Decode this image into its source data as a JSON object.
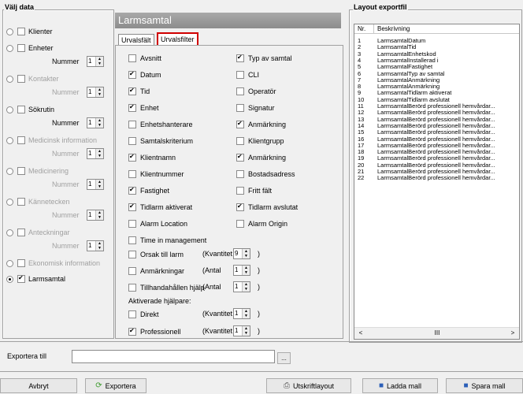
{
  "left": {
    "title": "Välj data",
    "number_label": "Nummer",
    "items": [
      {
        "label": "Klienter",
        "enabled": true,
        "selected": false,
        "checked": false,
        "number": null
      },
      {
        "label": "Enheter",
        "enabled": true,
        "selected": false,
        "checked": false,
        "number": "1"
      },
      {
        "label": "Kontakter",
        "enabled": false,
        "selected": false,
        "checked": false,
        "number": "1"
      },
      {
        "label": "Sökrutin",
        "enabled": true,
        "selected": false,
        "checked": false,
        "number": "1"
      },
      {
        "label": "Medicinsk information",
        "enabled": false,
        "selected": false,
        "checked": false,
        "number": "1"
      },
      {
        "label": "Medicinering",
        "enabled": false,
        "selected": false,
        "checked": false,
        "number": "1"
      },
      {
        "label": "Kännetecken",
        "enabled": false,
        "selected": false,
        "checked": false,
        "number": "1"
      },
      {
        "label": "Anteckningar",
        "enabled": false,
        "selected": false,
        "checked": false,
        "number": "1"
      },
      {
        "label": "Ekonomisk information",
        "enabled": false,
        "selected": false,
        "checked": false,
        "number": null
      },
      {
        "label": "Larmsamtal",
        "enabled": true,
        "selected": true,
        "checked": true,
        "number": null
      }
    ]
  },
  "header": {
    "title": "Larmsamtal"
  },
  "tabs": [
    {
      "label": "Urvalsfält",
      "selected": false
    },
    {
      "label": "Urvalsfilter",
      "selected": true
    }
  ],
  "options_left": [
    {
      "label": "Avsnitt",
      "checked": false
    },
    {
      "label": "Datum",
      "checked": true
    },
    {
      "label": "Tid",
      "checked": true
    },
    {
      "label": "Enhet",
      "checked": true
    },
    {
      "label": "Enhetshanterare",
      "checked": false
    },
    {
      "label": "Samtalskriterium",
      "checked": false
    },
    {
      "label": "Klientnamn",
      "checked": true
    },
    {
      "label": "Klientnummer",
      "checked": false
    },
    {
      "label": "Fastighet",
      "checked": true
    },
    {
      "label": "Tidlarm aktiverat",
      "checked": true
    },
    {
      "label": "Alarm Location",
      "checked": false
    },
    {
      "label": "Time in management",
      "checked": false
    }
  ],
  "options_right": [
    {
      "label": "Typ av samtal",
      "checked": true
    },
    {
      "label": "CLI",
      "checked": false
    },
    {
      "label": "Operatör",
      "checked": false
    },
    {
      "label": "Signatur",
      "checked": false
    },
    {
      "label": "Anmärkning",
      "checked": true
    },
    {
      "label": "Klientgrupp",
      "checked": false
    },
    {
      "label": "Anmärkning",
      "checked": true
    },
    {
      "label": "Bostadsadress",
      "checked": false
    },
    {
      "label": "Fritt fält",
      "checked": false
    },
    {
      "label": "Tidlarm avslutat",
      "checked": true
    },
    {
      "label": "Alarm Origin",
      "checked": false
    }
  ],
  "count_rows": [
    {
      "label": "Orsak till larm",
      "qty_label": "(Kvantitet",
      "value": "9",
      "close": ")",
      "checked": false
    },
    {
      "label": "Anmärkningar",
      "qty_label": "(Antal",
      "value": "1",
      "close": ")",
      "checked": false
    },
    {
      "label": "Tillhandahållen hjälp",
      "qty_label": "(Antal",
      "value": "1",
      "close": ")",
      "checked": false
    }
  ],
  "helpers": {
    "title": "Aktiverade hjälpare:",
    "items": [
      {
        "label": "Direkt",
        "qty_label": "(Kvantitet",
        "value": "1",
        "close": ")",
        "checked": false
      },
      {
        "label": "Professionell",
        "qty_label": "(Kvantitet",
        "value": "1",
        "close": ")",
        "checked": true
      }
    ]
  },
  "layout": {
    "title": "Layout exportfil",
    "col_nr": "Nr.",
    "col_desc": "Beskrivning",
    "rows": [
      {
        "nr": "1",
        "desc": "LarmsamtalDatum"
      },
      {
        "nr": "2",
        "desc": "LarmsamtalTid"
      },
      {
        "nr": "3",
        "desc": "LarmsamtalEnhetskod"
      },
      {
        "nr": "4",
        "desc": "LarmsamtalInstallerad i"
      },
      {
        "nr": "5",
        "desc": "LarmsamtalFastighet"
      },
      {
        "nr": "6",
        "desc": "LarmsamtalTyp av samtal"
      },
      {
        "nr": "7",
        "desc": "LarmsamtalAnmärkning"
      },
      {
        "nr": "8",
        "desc": "LarmsamtalAnmärkning"
      },
      {
        "nr": "9",
        "desc": "LarmsamtalTidlarm aktiverat"
      },
      {
        "nr": "10",
        "desc": "LarmsamtalTidlarm avslutat"
      },
      {
        "nr": "11",
        "desc": "LarmsamtalBerörd professionell hemvårdar..."
      },
      {
        "nr": "12",
        "desc": "LarmsamtalBerörd professionell hemvårdar..."
      },
      {
        "nr": "13",
        "desc": "LarmsamtalBerörd professionell hemvårdar..."
      },
      {
        "nr": "14",
        "desc": "LarmsamtalBerörd professionell hemvårdar..."
      },
      {
        "nr": "15",
        "desc": "LarmsamtalBerörd professionell hemvårdar..."
      },
      {
        "nr": "16",
        "desc": "LarmsamtalBerörd professionell hemvårdar..."
      },
      {
        "nr": "17",
        "desc": "LarmsamtalBerörd professionell hemvårdar..."
      },
      {
        "nr": "18",
        "desc": "LarmsamtalBerörd professionell hemvårdar..."
      },
      {
        "nr": "19",
        "desc": "LarmsamtalBerörd professionell hemvårdar..."
      },
      {
        "nr": "20",
        "desc": "LarmsamtalBerörd professionell hemvårdar..."
      },
      {
        "nr": "21",
        "desc": "LarmsamtalBerörd professionell hemvårdar..."
      },
      {
        "nr": "22",
        "desc": "LarmsamtalBerörd professionell hemvårdar..."
      }
    ],
    "scroll_mid": "III"
  },
  "export": {
    "label": "Exportera till",
    "value": "",
    "browse": "..."
  },
  "buttons": {
    "cancel": "Avbryt",
    "export": "Exportera",
    "print": "Utskriftlayout",
    "load": "Ladda mall",
    "save": "Spara mall"
  },
  "icons": {
    "spin_up": "▲",
    "spin_down": "▼",
    "scroll_left": "<",
    "scroll_right": ">",
    "export_icon": "export-icon",
    "print_icon": "printer-icon",
    "load_icon": "floppy-disk-icon",
    "save_icon": "floppy-disk-icon"
  }
}
